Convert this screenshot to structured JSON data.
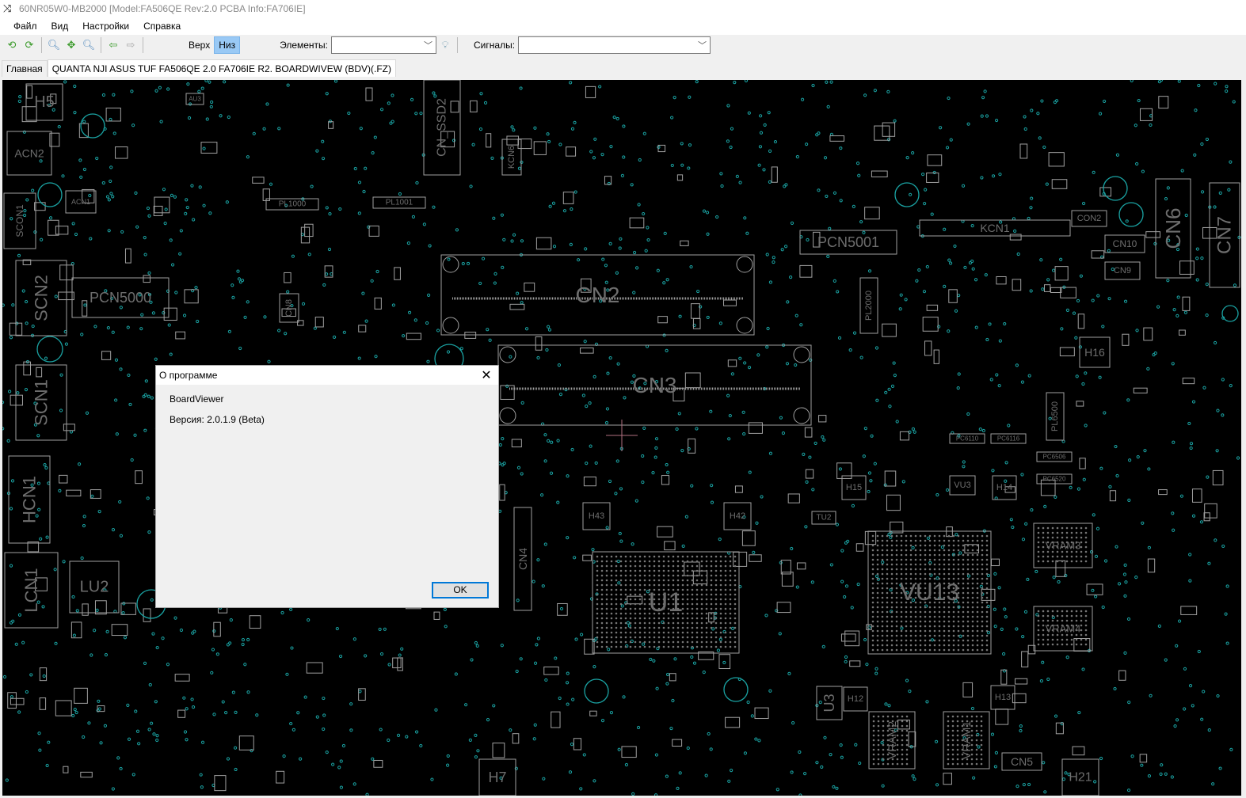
{
  "window": {
    "title": "60NR05W0-MB2000 [Model:FA506QE Rev:2.0 PCBA Info:FA706IE]"
  },
  "menu": [
    "Файл",
    "Вид",
    "Настройки",
    "Справка"
  ],
  "toolbar": {
    "top_label": "Верх",
    "bottom_label": "Низ",
    "elements_label": "Элементы:",
    "elements_value": "",
    "signals_label": "Сигналы:",
    "signals_value": ""
  },
  "tabs": [
    {
      "label": "Главная"
    },
    {
      "label": "QUANTA NJI ASUS TUF FA506QE 2.0  FA706IE R2. BOARDWIVEW (BDV)(.FZ)"
    }
  ],
  "board": {
    "colors": {
      "outline": "#a0a0a0",
      "pad": "#1aa3a3",
      "label": "#6e6e6e",
      "cursor": "#b07080"
    },
    "components": [
      "H5",
      "ACN2",
      "SCON1",
      "SCN2",
      "PCN5000",
      "SCN1",
      "HCN1",
      "LCN1",
      "LU2",
      "CN_SSD2",
      "KCN6",
      "PL1000",
      "PL1001",
      "CN2",
      "CN3",
      "CN8",
      "PCN5001",
      "KCN1",
      "CON2",
      "CN10",
      "CN9",
      "CN6",
      "CN7",
      "H16",
      "PL2000",
      "PL6500",
      "H43",
      "H42",
      "CN4",
      "U1",
      "VU13",
      "VRAM3",
      "VRAM4",
      "VRAM2",
      "VRAM1",
      "U3",
      "H12",
      "H13",
      "CN5",
      "H21",
      "H7",
      "H15",
      "H14",
      "VU3",
      "TU2",
      "ACN1",
      "AU3",
      "PC6506",
      "PC6520",
      "PC6110",
      "PC6116"
    ]
  },
  "dialog": {
    "title": "О программе",
    "app_name": "BoardViewer",
    "version": "Версия: 2.0.1.9 (Beta)",
    "ok_label": "OK"
  }
}
